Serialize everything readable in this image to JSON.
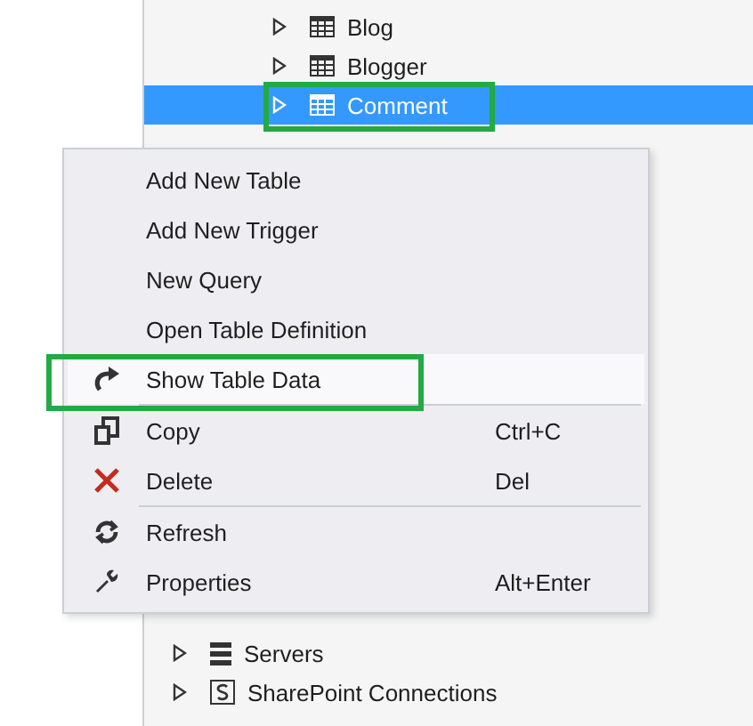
{
  "tree": {
    "tables": [
      {
        "label": "Blog",
        "selected": false,
        "annotated": false
      },
      {
        "label": "Blogger",
        "selected": false,
        "annotated": false
      },
      {
        "label": "Comment",
        "selected": true,
        "annotated": true
      }
    ],
    "nodes": [
      {
        "label": "Servers"
      },
      {
        "label": "SharePoint Connections"
      }
    ]
  },
  "context_menu": {
    "items": [
      {
        "kind": "item",
        "label": "Add New Table",
        "selected": false,
        "annotated": false
      },
      {
        "kind": "item",
        "label": "Add New Trigger",
        "selected": false,
        "annotated": false
      },
      {
        "kind": "item",
        "label": "New Query",
        "selected": false,
        "annotated": false
      },
      {
        "kind": "item",
        "label": "Open Table Definition",
        "selected": false,
        "annotated": false
      },
      {
        "kind": "item",
        "label": "Show Table Data",
        "selected": true,
        "annotated": true
      },
      {
        "kind": "separator"
      },
      {
        "kind": "item",
        "label": "Copy",
        "shortcut": "Ctrl+C",
        "selected": false,
        "annotated": false
      },
      {
        "kind": "item",
        "label": "Delete",
        "shortcut": "Del",
        "selected": false,
        "annotated": false
      },
      {
        "kind": "separator"
      },
      {
        "kind": "item",
        "label": "Refresh",
        "selected": false,
        "annotated": false
      },
      {
        "kind": "item",
        "label": "Properties",
        "shortcut": "Alt+Enter",
        "selected": false,
        "annotated": false
      }
    ]
  }
}
